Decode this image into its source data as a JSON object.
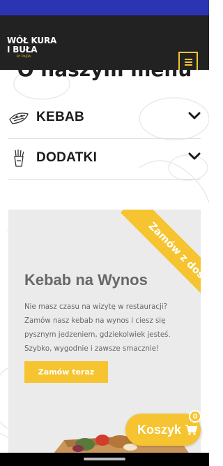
{
  "header": {
    "logo": {
      "line1": "WÓŁ KURA",
      "line2": "I BUŁA",
      "tagline": "BY PAJDA"
    },
    "menu_icon": "hamburger-icon"
  },
  "menu_section": {
    "title": "O naszym menu",
    "items": [
      {
        "label": "KEBAB",
        "icon": "kebab-icon"
      },
      {
        "label": "DODATKI",
        "icon": "fries-icon"
      }
    ]
  },
  "promo": {
    "ribbon": "Zamów z dostawą",
    "title": "Kebab na Wynos",
    "description": "Nie masz czasu na wizytę w restauracji? Zamów nasz kebab na wynos i ciesz się pysznym jedzeniem, gdziekolwiek jesteś. Szybko, wygodnie i zawsze smacznie!",
    "button_label": "Zamów teraz"
  },
  "cart": {
    "label": "Koszyk",
    "count": "0",
    "icon": "cart-icon"
  },
  "colors": {
    "accent": "#f5c430",
    "header_bg": "#222222",
    "statusbar": "#2b35b4"
  }
}
